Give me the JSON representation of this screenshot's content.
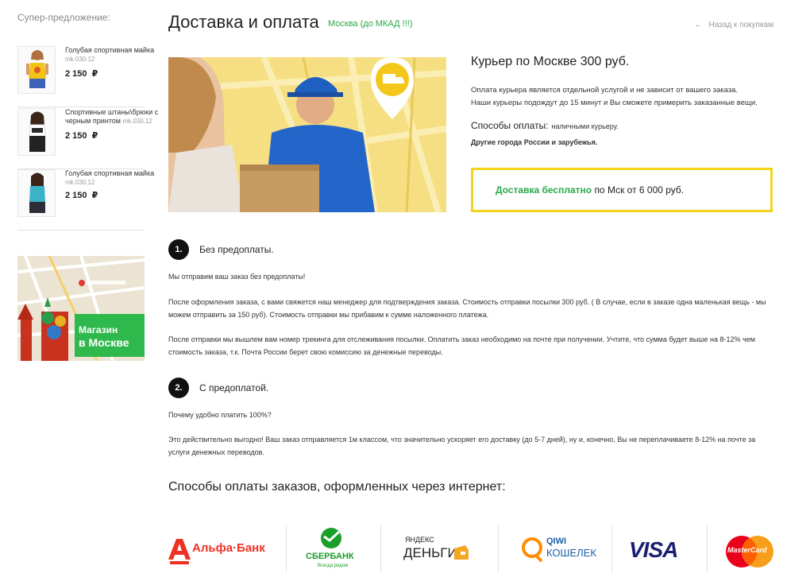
{
  "sidebar": {
    "title": "Супер-предложение:",
    "products": [
      {
        "name": "Голубая спортивная майка",
        "sku": "mk.030.12",
        "price": "2 150",
        "currency": "₽"
      },
      {
        "name": "Спортивные штаны\\брюки с черным принтом",
        "sku": "mk.030.12",
        "price": "2 150",
        "currency": "₽"
      },
      {
        "name": "Голубая спортивная майка",
        "sku": "mk.030.12",
        "price": "2 150",
        "currency": "₽"
      }
    ],
    "map_banner": {
      "line1": "Магазин",
      "line2": "в Москве"
    }
  },
  "header": {
    "title": "Доставка и оплата",
    "city": "Москва (до МКАД !!!)",
    "back_link": "Назад к покупкам"
  },
  "courier": {
    "title": "Курьер по Москве 300 руб.",
    "desc_line1": "Оплата курьера является отдельной услугой и не зависит от вашего заказа.",
    "desc_line2": "Наши курьеры подождут до 15 минут и Вы сможете примерить заказанные вещи.",
    "pay_methods_label": "Способы оплаты:",
    "pay_methods_value": "наличными курьеру.",
    "other_cities": "Другие города России и зарубежья.",
    "free_highlight": "Доставка бесплатно",
    "free_rest": "по Мск от 6 000 руб."
  },
  "steps": [
    {
      "num": "1.",
      "title": "Без предоплаты.",
      "paragraphs": [
        "Мы отправим ваш заказ без предоплаты!",
        "После оформления заказа, с вами свяжется наш менеджер для подтверждения заказа. Стоимость отправки посылки 300 руб. ( В случае, если в заказе одна маленькая вещь - мы можем отправить за 150 руб). Стоимость отправки мы прибавим к сумме наложенного платежа.",
        "После отправки мы вышлем вам номер трекинга для отслеживания посылки. Оплатить заказ необходимо на почте при получении. Учтите, что сумма будет выше на 8-12% чем стоимость заказа, т.к. Почта России берет свою комиссию за денежные переводы."
      ]
    },
    {
      "num": "2.",
      "title": "С предоплатой.",
      "paragraphs": [
        "Почему удобно платить 100%?",
        "Это действительно выгодно! Ваш заказ отправляется 1м классом, что значительно ускоряет его доставку (до 5-7 дней), ну и, конечно, Вы не переплачиваете 8-12% на почте за услуги денежных переводов."
      ]
    }
  ],
  "payments": {
    "title": "Способы оплаты заказов, оформленных через интернет:",
    "logos": [
      {
        "name": "Альфа·Банк",
        "icon": "alfa-bank-logo",
        "color": "#ef3124"
      },
      {
        "name": "СБЕРБАНК",
        "sub": "Всегда рядом",
        "icon": "sberbank-logo",
        "color": "#1a9f29"
      },
      {
        "name": "ДЕНЬГИ",
        "sub": "ЯНДЕКС",
        "icon": "yandex-money-logo",
        "color": "#f5a623"
      },
      {
        "name": "QIWI",
        "sub": "КОШЕЛЕК",
        "icon": "qiwi-logo",
        "color": "#ff8c00"
      },
      {
        "name": "VISA",
        "icon": "visa-logo",
        "color": "#1a1f71"
      },
      {
        "name": "MasterCard",
        "icon": "mastercard-logo",
        "color": "#eb001b"
      }
    ]
  }
}
